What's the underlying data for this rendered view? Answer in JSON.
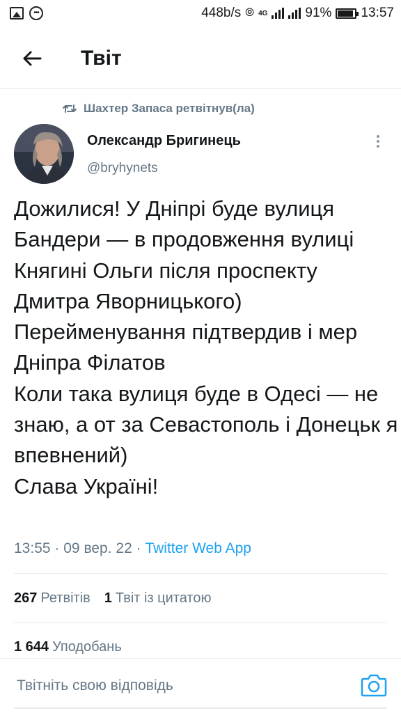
{
  "status_bar": {
    "speed": "448b/s",
    "network": "4G",
    "battery": "91%",
    "time": "13:57",
    "icons": [
      "gallery-icon",
      "more-notifications-icon",
      "hotspot-icon",
      "signal-icon",
      "battery-icon"
    ]
  },
  "header": {
    "title": "Твіт",
    "back_icon": "arrow-left-icon"
  },
  "retweet": {
    "icon": "retweet-icon",
    "text": "Шахтер Запаса ретвітнув(ла)"
  },
  "author": {
    "name": "Олександр Бригинець",
    "handle": "@bryhynets",
    "more_icon": "more-vertical-icon"
  },
  "tweet": {
    "text": "Дожилися! У Дніпрі буде вулиця Бандери — в продовження вулиці Княгині Ольги після проспекту Дмитра Яворницького)\nПерейменування підтвердив і мер Дніпра Філатов\nКоли така вулиця буде в Одесі — не знаю, а от за Севастополь і Донецьк я впевнений)\nСлава Україні!",
    "time": "13:55",
    "date": "09 вер. 22",
    "separator": "·",
    "app": "Twitter Web App"
  },
  "stats": {
    "retweets_count": "267",
    "retweets_label": "Ретвітів",
    "quotes_count": "1",
    "quotes_label": "Твіт із цитатою",
    "likes_count": "1 644",
    "likes_label": "Уподобань"
  },
  "reply": {
    "placeholder": "Твітніть свою відповідь",
    "camera_icon": "camera-icon"
  },
  "colors": {
    "accent": "#1da1f2",
    "secondary_text": "#657786",
    "primary_text": "#14171a",
    "divider": "#e6ecf0"
  }
}
